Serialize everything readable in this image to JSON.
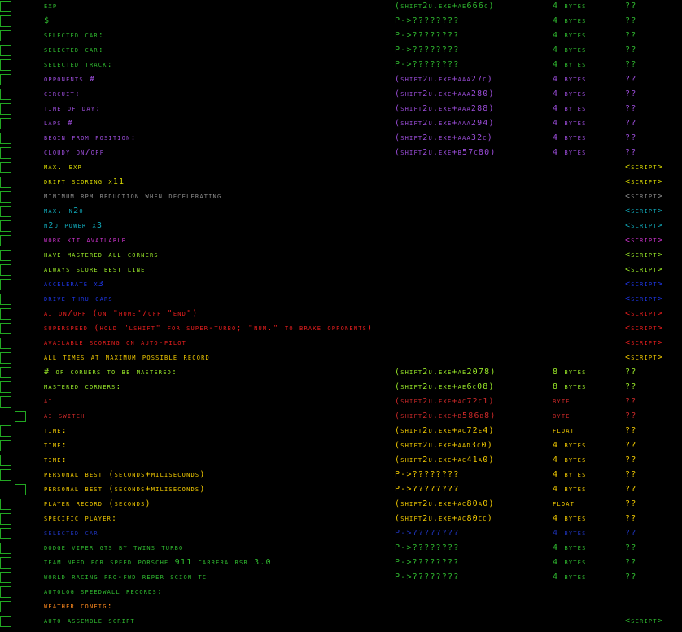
{
  "colors": {
    "green": "#2fb82f",
    "purple": "#9a4cd8",
    "yellow": "#d8d800",
    "gray": "#8a8a8a",
    "cyan": "#11a8b8",
    "magenta": "#c832c8",
    "lime": "#98e628",
    "blue": "#1e36e6",
    "red": "#e61e1e",
    "orange": "#ff8a1e",
    "gold": "#f0c800",
    "darkred": "#c82828",
    "darkblue": "#1e32b4",
    "checkbox_border": "#22a822"
  },
  "rows": [
    {
      "desc": "exp",
      "addr": "(shift2u.exe+ae666c)",
      "type": "4 bytes",
      "val": "??",
      "color": "green",
      "indent": 0
    },
    {
      "desc": "$",
      "addr": "P->????????",
      "type": "4 bytes",
      "val": "??",
      "color": "green",
      "indent": 0
    },
    {
      "desc": "selected car:",
      "addr": "P->????????",
      "type": "4 bytes",
      "val": "??",
      "color": "green",
      "indent": 0
    },
    {
      "desc": "selected car:",
      "addr": "P->????????",
      "type": "4 bytes",
      "val": "??",
      "color": "green",
      "indent": 0
    },
    {
      "desc": "selected track:",
      "addr": "P->????????",
      "type": "4 bytes",
      "val": "??",
      "color": "green",
      "indent": 0
    },
    {
      "desc": "opponents #",
      "addr": "(shift2u.exe+aaa27c)",
      "type": "4 bytes",
      "val": "??",
      "color": "purple",
      "indent": 0
    },
    {
      "desc": "circuit:",
      "addr": "(shift2u.exe+aaa280)",
      "type": "4 bytes",
      "val": "??",
      "color": "purple",
      "indent": 0
    },
    {
      "desc": "time of day:",
      "addr": "(shift2u.exe+aaa288)",
      "type": "4 bytes",
      "val": "??",
      "color": "purple",
      "indent": 0
    },
    {
      "desc": "laps #",
      "addr": "(shift2u.exe+aaa294)",
      "type": "4 bytes",
      "val": "??",
      "color": "purple",
      "indent": 0
    },
    {
      "desc": "begin from position:",
      "addr": "(shift2u.exe+aaa32c)",
      "type": "4 bytes",
      "val": "??",
      "color": "purple",
      "indent": 0
    },
    {
      "desc": "cloudy on/off",
      "addr": "(shift2u.exe+b57c80)",
      "type": "4 bytes",
      "val": "??",
      "color": "purple",
      "indent": 0
    },
    {
      "desc": "max. exp",
      "addr": "",
      "type": "",
      "val": "<script>",
      "color": "yellow",
      "indent": 0
    },
    {
      "desc": "drift scoring x11",
      "addr": "",
      "type": "",
      "val": "<script>",
      "color": "yellow",
      "indent": 0
    },
    {
      "desc": "minimum rpm reduction when decelerating",
      "addr": "",
      "type": "",
      "val": "<script>",
      "color": "gray",
      "indent": 0
    },
    {
      "desc": "max. n2o",
      "addr": "",
      "type": "",
      "val": "<script>",
      "color": "cyan",
      "indent": 0
    },
    {
      "desc": "n2o power x3",
      "addr": "",
      "type": "",
      "val": "<script>",
      "color": "cyan",
      "indent": 0
    },
    {
      "desc": "work kit available",
      "addr": "",
      "type": "",
      "val": "<script>",
      "color": "magenta",
      "indent": 0
    },
    {
      "desc": "have mastered all corners",
      "addr": "",
      "type": "",
      "val": "<script>",
      "color": "lime",
      "indent": 0
    },
    {
      "desc": "always score best line",
      "addr": "",
      "type": "",
      "val": "<script>",
      "color": "lime",
      "indent": 0
    },
    {
      "desc": "accelerate x3",
      "addr": "",
      "type": "",
      "val": "<script>",
      "color": "blue",
      "indent": 0
    },
    {
      "desc": "drive thru cars",
      "addr": "",
      "type": "",
      "val": "<script>",
      "color": "blue",
      "indent": 0
    },
    {
      "desc": "ai on/off (on \"home\"/off \"end\")",
      "addr": "",
      "type": "",
      "val": "<script>",
      "color": "red",
      "indent": 0
    },
    {
      "desc": "superspeed (hold \"lshift\" for super-turbo; \"num.\" to brake opponents)",
      "addr": "",
      "type": "",
      "val": "<script>",
      "color": "red",
      "indent": 0
    },
    {
      "desc": "available scoring on auto-pilot",
      "addr": "",
      "type": "",
      "val": "<script>",
      "color": "red",
      "indent": 0
    },
    {
      "desc": "all times at maximum possible record",
      "addr": "",
      "type": "",
      "val": "<script>",
      "color": "gold",
      "indent": 0
    },
    {
      "desc": "# of corners to be mastered:",
      "addr": "(shift2u.exe+ae2078)",
      "type": "8 bytes",
      "val": "??",
      "color": "lime",
      "indent": 0
    },
    {
      "desc": "mastered corners:",
      "addr": "(shift2u.exe+ae6c08)",
      "type": "8 bytes",
      "val": "??",
      "color": "lime",
      "indent": 0
    },
    {
      "desc": "ai",
      "addr": "(shift2u.exe+ac72c1)",
      "type": "byte",
      "val": "??",
      "color": "darkred",
      "indent": 0
    },
    {
      "desc": "ai switch",
      "addr": "(shift2u.exe+b586b8)",
      "type": "byte",
      "val": "??",
      "color": "darkred",
      "indent": 1
    },
    {
      "desc": "time:",
      "addr": "(shift2u.exe+ac72e4)",
      "type": "float",
      "val": "??",
      "color": "gold",
      "indent": 0
    },
    {
      "desc": "time:",
      "addr": "(shift2u.exe+aad3c0)",
      "type": "4 bytes",
      "val": "??",
      "color": "gold",
      "indent": 0
    },
    {
      "desc": "time:",
      "addr": "(shift2u.exe+ac41a0)",
      "type": "4 bytes",
      "val": "??",
      "color": "gold",
      "indent": 0
    },
    {
      "desc": "personal best (seconds+miliseconds)",
      "addr": "P->????????",
      "type": "4 bytes",
      "val": "??",
      "color": "gold",
      "indent": 0
    },
    {
      "desc": "personal best (seconds+miliseconds)",
      "addr": "P->????????",
      "type": "4 bytes",
      "val": "??",
      "color": "gold",
      "indent": 1
    },
    {
      "desc": "player record (seconds)",
      "addr": "(shift2u.exe+ac80a0)",
      "type": "float",
      "val": "??",
      "color": "gold",
      "indent": 0
    },
    {
      "desc": "specific player:",
      "addr": "(shift2u.exe+ac80cc)",
      "type": "4 bytes",
      "val": "??",
      "color": "gold",
      "indent": 0
    },
    {
      "desc": "selected car",
      "addr": "P->????????",
      "type": "4 bytes",
      "val": "??",
      "color": "darkblue",
      "indent": 0
    },
    {
      "desc": "dodge viper gts by twins turbo",
      "addr": "P->????????",
      "type": "4 bytes",
      "val": "??",
      "color": "green",
      "indent": 0
    },
    {
      "desc": "team need for speed porsche 911 carrera rsr 3.0",
      "addr": "P->????????",
      "type": "4 bytes",
      "val": "??",
      "color": "green",
      "indent": 0
    },
    {
      "desc": "world racing pro-fwd reper scion tc",
      "addr": "P->????????",
      "type": "4 bytes",
      "val": "??",
      "color": "green",
      "indent": 0
    },
    {
      "desc": "autolog speedwall records:",
      "addr": "",
      "type": "",
      "val": "",
      "color": "green",
      "indent": 0
    },
    {
      "desc": "weather config:",
      "addr": "",
      "type": "",
      "val": "",
      "color": "orange",
      "indent": 0
    },
    {
      "desc": "auto assemble script",
      "addr": "",
      "type": "",
      "val": "<script>",
      "color": "green",
      "indent": 0
    }
  ]
}
